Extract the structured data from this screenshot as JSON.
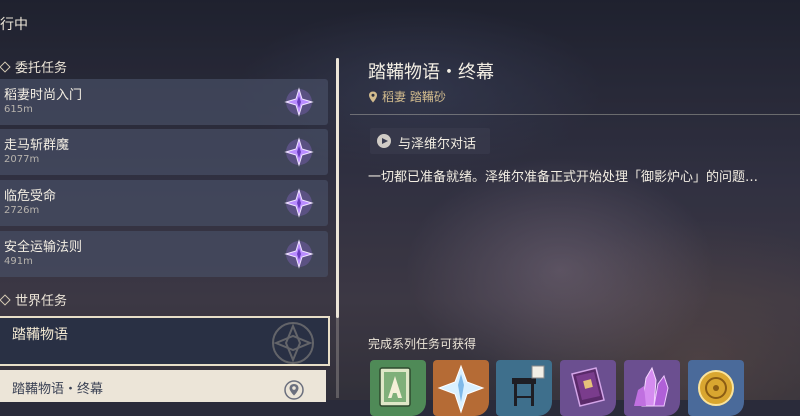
{
  "header": {
    "title": "行中"
  },
  "commission": {
    "label": "委托任务",
    "quests": [
      {
        "name": "稻妻时尚入门",
        "distance": "615m"
      },
      {
        "name": "走马斩群魔",
        "distance": "2077m"
      },
      {
        "name": "临危受命",
        "distance": "2726m"
      },
      {
        "name": "安全运输法则",
        "distance": "491m"
      }
    ]
  },
  "world": {
    "label": "世界任务",
    "selected_quest": "踏鞴物语",
    "sub_quest": "踏鞴物语・终幕"
  },
  "detail": {
    "title": "踏鞴物语・终幕",
    "location": "稻妻 踏鞴砂",
    "step": "与泽维尔对话",
    "description": "一切都已准备就绪。泽维尔准备正式开始处理「御影炉心」的问题…"
  },
  "rewards": {
    "label": "完成系列任务可获得",
    "items": [
      {
        "icon": "book-item-icon",
        "color": "#4f8a57"
      },
      {
        "icon": "primogem-icon",
        "color": "#b56b35"
      },
      {
        "icon": "furniture-stool-icon",
        "color": "#3e6f8c"
      },
      {
        "icon": "purple-book-icon",
        "color": "#6b4f90"
      },
      {
        "icon": "crystal-ore-icon",
        "color": "#6b4f90"
      },
      {
        "icon": "mora-coin-icon",
        "color": "#4a6a9a"
      }
    ]
  },
  "colors": {
    "accent_gold": "#d3bc8e",
    "panel": "#ece5d8",
    "quest_icon": "#8a5cd6"
  }
}
